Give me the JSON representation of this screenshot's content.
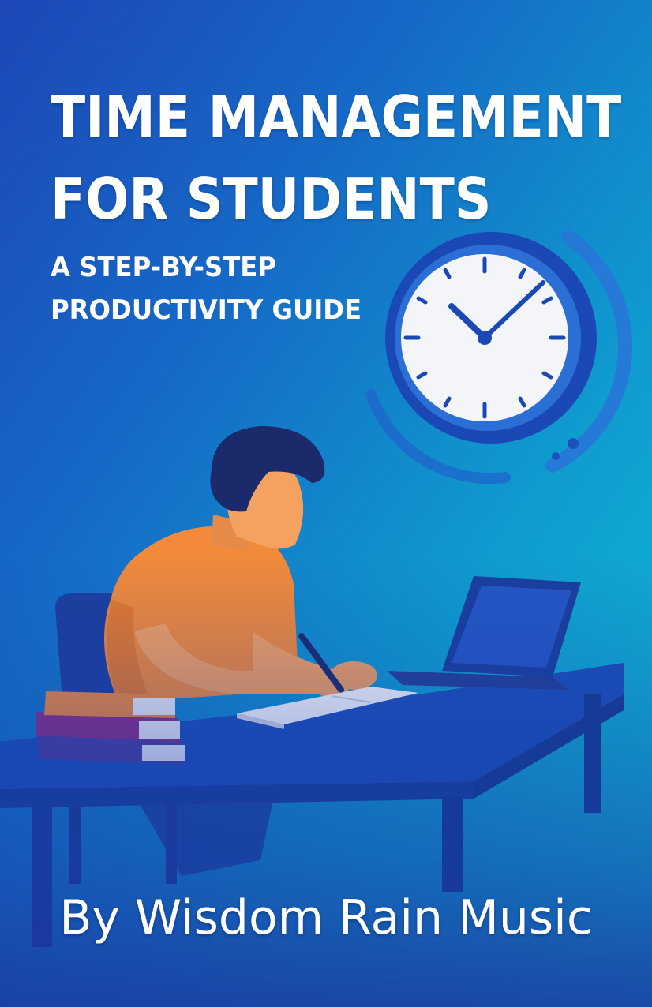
{
  "cover": {
    "title_lines": [
      "TIME MANAGEMENT",
      "FOR STUDENTS"
    ],
    "subtitle_lines": [
      "A STEP-BY-STEP",
      "PRODUCTIVITY GUIDE"
    ],
    "author": "By Wisdom Rain Music"
  },
  "illustration": {
    "icons": [
      "clock-icon",
      "student-figure",
      "laptop-icon",
      "open-notebook-icon",
      "book-stack-icon",
      "pen-icon",
      "desk",
      "chair"
    ]
  },
  "colors": {
    "background_start": "#1d47b6",
    "background_end": "#10c3d2",
    "shirt": "#f28a3a",
    "skin": "#f5a15f",
    "hair": "#1b2a6b",
    "desk": "#1c50b8",
    "clock_face": "#f4f5f8",
    "clock_rim": "#1a49b5"
  }
}
